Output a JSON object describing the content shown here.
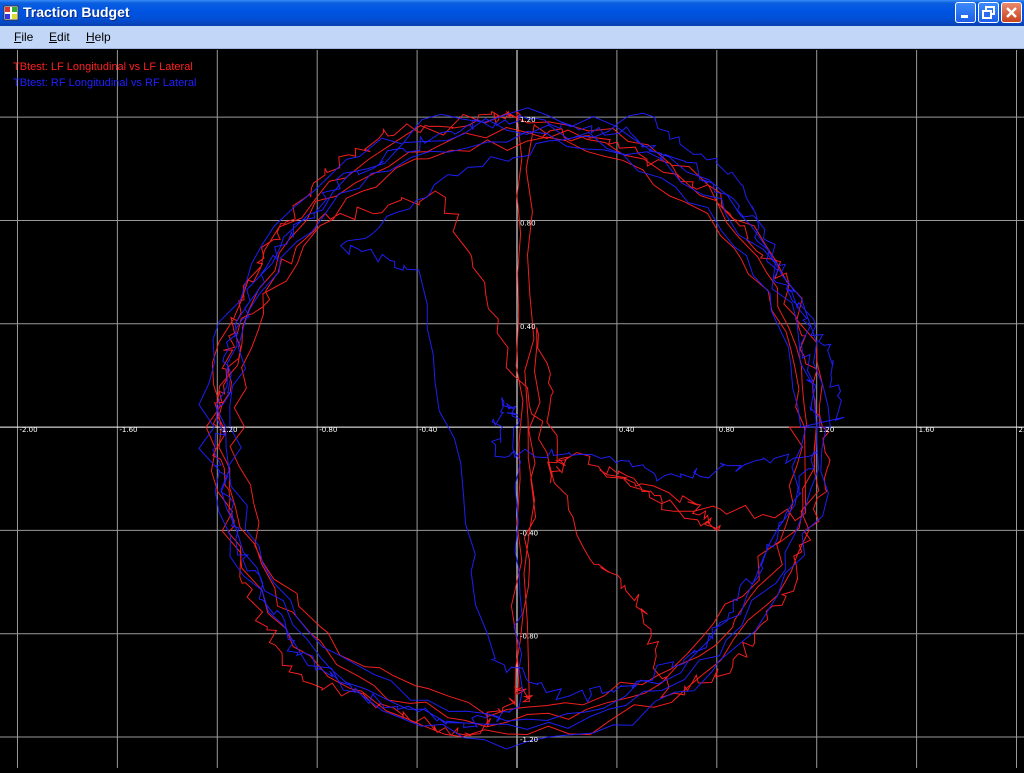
{
  "window": {
    "title": "Traction Budget"
  },
  "menu": {
    "items": [
      "File",
      "Edit",
      "Help"
    ]
  },
  "legend": [
    {
      "label": "TBtest: LF Longitudinal vs LF Lateral",
      "color": "#ff2020"
    },
    {
      "label": "TBtest: RF Longitudinal vs RF Lateral",
      "color": "#2020ff"
    }
  ],
  "chart_data": {
    "type": "scatter",
    "grid": true,
    "background": "#000000",
    "x_ticks": [
      "-2.00",
      "-1.60",
      "-1.20",
      "-0.80",
      "-0.40",
      "0.40",
      "0.80",
      "1.20",
      "1.60",
      "2.00"
    ],
    "x_tick_values": [
      -2.0,
      -1.6,
      -1.2,
      -0.8,
      -0.4,
      0.4,
      0.8,
      1.2,
      1.6,
      2.0
    ],
    "y_ticks": [
      "1.20",
      "0.80",
      "0.40",
      "-0.40",
      "-0.80",
      "-1.20"
    ],
    "y_tick_values": [
      1.2,
      0.8,
      0.4,
      -0.4,
      -0.8,
      -1.2
    ],
    "xlim": [
      -2.07,
      2.03
    ],
    "ylim": [
      -1.32,
      1.46
    ],
    "series": [
      {
        "name": "TBtest: LF Longitudinal vs LF Lateral",
        "color": "#ff2020",
        "seed": 7,
        "points": [
          [
            -1.2,
            0.0
          ],
          [
            -1.15,
            0.35
          ],
          [
            -1.0,
            0.7
          ],
          [
            -0.8,
            0.95
          ],
          [
            -0.5,
            1.15
          ],
          [
            -0.1,
            1.2
          ],
          [
            0.0,
            1.2
          ],
          [
            0.0,
            -1.0
          ],
          [
            0.05,
            -1.05
          ],
          [
            0.05,
            1.15
          ],
          [
            0.4,
            1.1
          ],
          [
            0.8,
            0.9
          ],
          [
            1.05,
            0.6
          ],
          [
            1.2,
            0.2
          ],
          [
            1.25,
            -0.2
          ],
          [
            1.1,
            -0.6
          ],
          [
            0.9,
            -0.9
          ],
          [
            0.6,
            -1.05
          ],
          [
            0.5,
            -0.7
          ],
          [
            0.3,
            -0.5
          ],
          [
            0.0,
            0.2
          ],
          [
            -0.3,
            0.9
          ],
          [
            -0.8,
            0.8
          ],
          [
            -1.1,
            0.4
          ],
          [
            -1.2,
            -0.1
          ],
          [
            -1.1,
            -0.6
          ],
          [
            -0.9,
            -0.95
          ],
          [
            -0.5,
            -1.1
          ],
          [
            -0.2,
            -1.2
          ],
          [
            0.0,
            -1.05
          ],
          [
            0.1,
            0.4
          ],
          [
            0.15,
            -0.2
          ],
          [
            0.2,
            -0.1
          ],
          [
            0.7,
            -0.3
          ],
          [
            0.8,
            -0.4
          ],
          [
            0.35,
            -0.15
          ],
          [
            0.6,
            -0.3
          ],
          [
            1.2,
            -0.35
          ]
        ]
      },
      {
        "name": "TBtest: RF Longitudinal vs RF Lateral",
        "color": "#2020ff",
        "seed": 13,
        "points": [
          [
            1.2,
            0.0
          ],
          [
            1.15,
            0.4
          ],
          [
            1.0,
            0.75
          ],
          [
            0.7,
            1.0
          ],
          [
            0.4,
            1.15
          ],
          [
            0.0,
            1.2
          ],
          [
            -0.3,
            1.15
          ],
          [
            -0.7,
            0.95
          ],
          [
            -1.0,
            0.65
          ],
          [
            -1.15,
            0.3
          ],
          [
            -1.2,
            -0.1
          ],
          [
            -1.1,
            -0.5
          ],
          [
            -0.9,
            -0.85
          ],
          [
            -0.6,
            -1.05
          ],
          [
            -0.2,
            -1.15
          ],
          [
            0.0,
            -1.1
          ],
          [
            0.0,
            0.0
          ],
          [
            -0.05,
            0.1
          ],
          [
            -0.1,
            -0.1
          ],
          [
            0.3,
            -0.1
          ],
          [
            0.6,
            -0.2
          ],
          [
            0.9,
            -0.15
          ],
          [
            1.2,
            -0.1
          ],
          [
            1.0,
            -0.5
          ],
          [
            0.8,
            -0.8
          ],
          [
            0.5,
            -1.0
          ],
          [
            0.2,
            -1.05
          ],
          [
            -0.1,
            -0.9
          ],
          [
            -0.4,
            0.6
          ],
          [
            -0.7,
            0.7
          ],
          [
            -0.2,
            1.0
          ],
          [
            0.5,
            1.2
          ],
          [
            0.9,
            0.95
          ],
          [
            1.05,
            0.55
          ],
          [
            1.25,
            0.3
          ],
          [
            1.3,
            0.0
          ]
        ]
      }
    ]
  }
}
